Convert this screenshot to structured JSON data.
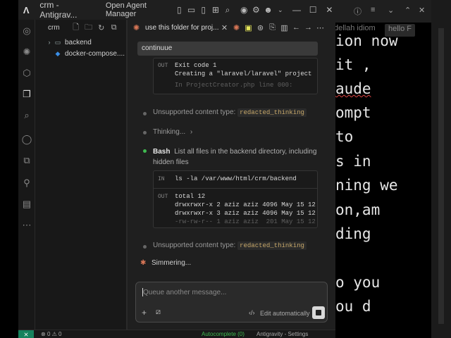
{
  "window": {
    "title": "crm - Antigrav...",
    "open_agent_manager": "Open Agent Manager"
  },
  "sidebar": {
    "workspace": "crm",
    "items": [
      {
        "label": "backend",
        "type": "folder"
      },
      {
        "label": "docker-compose....",
        "type": "docker-file"
      }
    ]
  },
  "panel": {
    "tab_title": "use this folder for proj...",
    "user_message": "continuue",
    "card1": {
      "out_label": "OUT",
      "lines": [
        "Exit code 1",
        "Creating a \"laravel/laravel\" project at \"",
        "In ProjectCreator.php line 000:"
      ]
    },
    "unsupported_prefix": "Unsupported content type:",
    "unsupported_chip": "redacted_thinking",
    "thinking": "Thinking...",
    "bash": {
      "label": "Bash",
      "description": "List all files in the backend directory, including hidden files"
    },
    "card2": {
      "in_label": "IN",
      "command": "ls -la /var/www/html/crm/backend",
      "out_label": "OUT",
      "lines": [
        "total 12",
        "drwxrwxr-x 2 aziz aziz 4096 May 15 12:39 .",
        "drwxrwxr-x 3 aziz aziz 4096 May 15 12:39 ..",
        "-rw-rw-r-- 1 aziz aziz  201 May 15 12:39"
      ]
    },
    "status": "Simmering...",
    "composer": {
      "placeholder": "Queue another message...",
      "edit_mode": "Edit automatically"
    }
  },
  "editor": {
    "tabs": [
      "dellah idiom",
      "hello F"
    ],
    "lines": [
      "ion now",
      "it ,",
      "aude",
      "ompt",
      "to",
      "s in",
      "ning we",
      "on,am",
      "ding",
      "",
      "o you",
      "ou d"
    ]
  },
  "statusbar": {
    "errors": "0",
    "warnings": "0",
    "autocomplete": "Autocomplete (0)",
    "settings": "Antigravity - Settings"
  }
}
